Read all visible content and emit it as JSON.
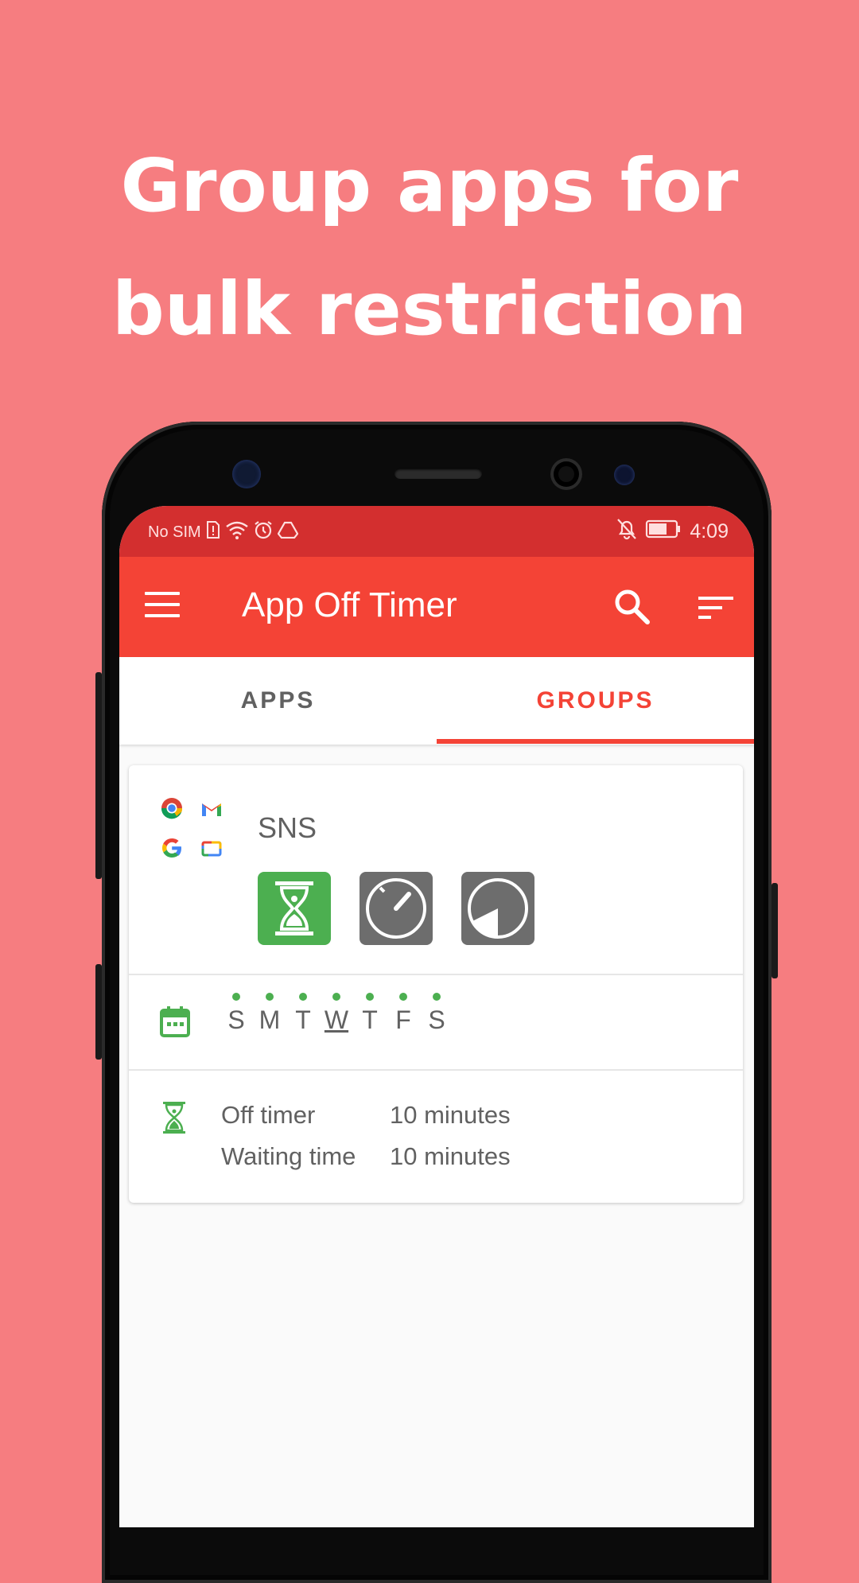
{
  "headline": {
    "line1": "Group apps for",
    "line2": "bulk restriction"
  },
  "status_bar": {
    "carrier": "No SIM",
    "time": "4:09"
  },
  "app_bar": {
    "title": "App Off Timer",
    "icons": [
      "menu-icon",
      "search-icon",
      "sort-icon"
    ]
  },
  "tabs": [
    {
      "label": "APPS",
      "selected": false
    },
    {
      "label": "GROUPS",
      "selected": true
    }
  ],
  "group": {
    "name": "SNS",
    "app_icons": [
      "chrome-icon",
      "gmail-icon",
      "google-icon",
      "google-tv-icon"
    ],
    "mode_tiles": [
      {
        "icon": "hourglass-icon",
        "active": true
      },
      {
        "icon": "stopwatch-icon",
        "active": false
      },
      {
        "icon": "pie-timer-icon",
        "active": false
      }
    ],
    "days": [
      "S",
      "M",
      "T",
      "W",
      "T",
      "F",
      "S"
    ],
    "today_index": 3,
    "off_timer_label": "Off timer",
    "off_timer_value": "10 minutes",
    "waiting_label": "Waiting time",
    "waiting_value": "10 minutes"
  },
  "colors": {
    "background": "#f67d80",
    "app_bar": "#f44336",
    "status_bar": "#d32f2f",
    "accent_green": "#4caf50",
    "inactive_tile": "#6d6d6d"
  }
}
